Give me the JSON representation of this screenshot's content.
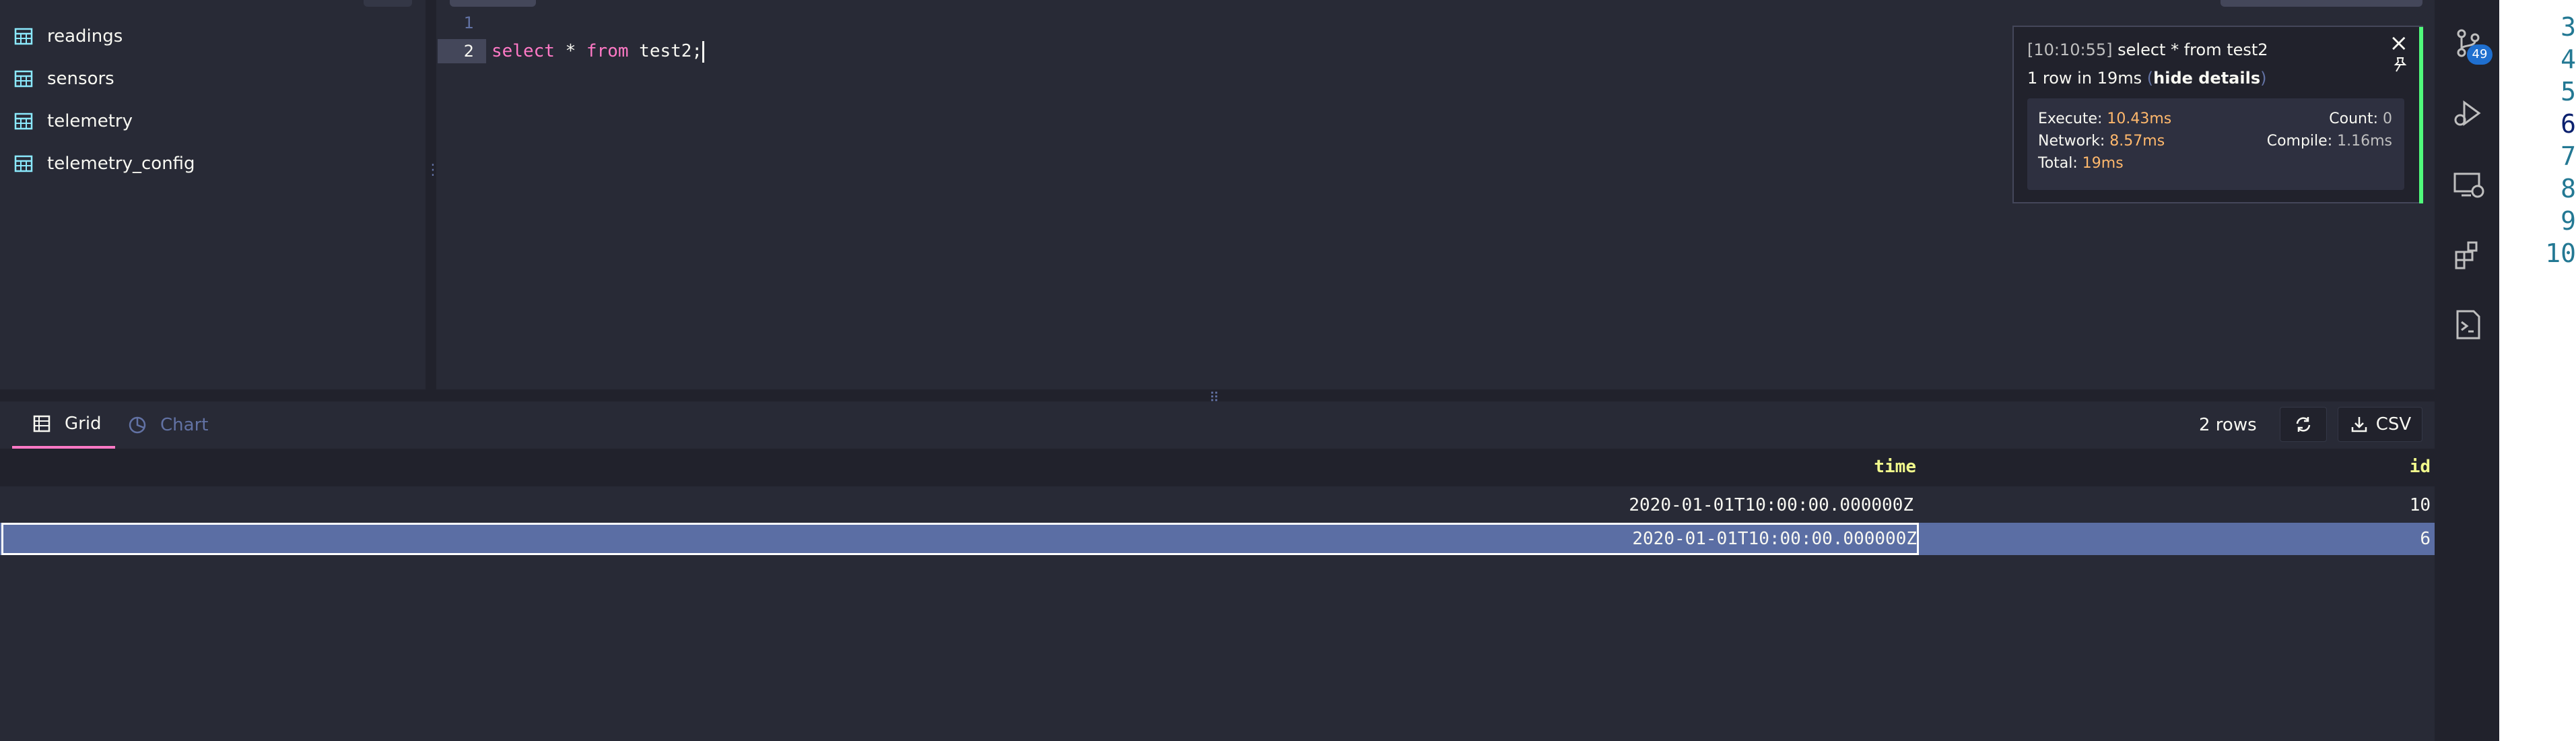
{
  "sidebar": {
    "tables": [
      {
        "label": "readings",
        "icon": "table-icon"
      },
      {
        "label": "sensors",
        "icon": "table-icon"
      },
      {
        "label": "telemetry",
        "icon": "table-icon"
      },
      {
        "label": "telemetry_config",
        "icon": "table-icon"
      }
    ]
  },
  "editor": {
    "line_numbers": [
      "1",
      "2"
    ],
    "code": {
      "keyword1": "select",
      "star": " * ",
      "keyword2": "from",
      "rest": " test2;"
    }
  },
  "notification": {
    "timestamp": "[10:10:55]",
    "query": "select * from test2",
    "summary_prefix": "1 row in 19ms",
    "paren_open": "(",
    "hide_details": "hide details",
    "paren_close": ")",
    "execute_label": "Execute:",
    "execute_value": "10.43ms",
    "network_label": "Network:",
    "network_value": "8.57ms",
    "total_label": "Total:",
    "total_value": "19ms",
    "count_label": "Count:",
    "count_value": "0",
    "compile_label": "Compile:",
    "compile_value": "1.16ms"
  },
  "activity_bar": {
    "badge": "49",
    "icons": [
      "source-control-icon",
      "run-debug-icon",
      "remote-explorer-icon",
      "extensions-icon",
      "terminal-icon"
    ]
  },
  "far_right_line_numbers": [
    "3",
    "4",
    "5",
    "6",
    "7",
    "8",
    "9",
    "10"
  ],
  "results": {
    "tabs": [
      {
        "label": "Grid"
      },
      {
        "label": "Chart"
      }
    ],
    "row_count": "2 rows",
    "csv_label": "CSV",
    "columns": [
      "time",
      "id"
    ],
    "rows": [
      [
        "2020-01-01T10:00:00.000000Z",
        "10"
      ],
      [
        "2020-01-01T10:00:00.000000Z",
        "6"
      ]
    ]
  }
}
